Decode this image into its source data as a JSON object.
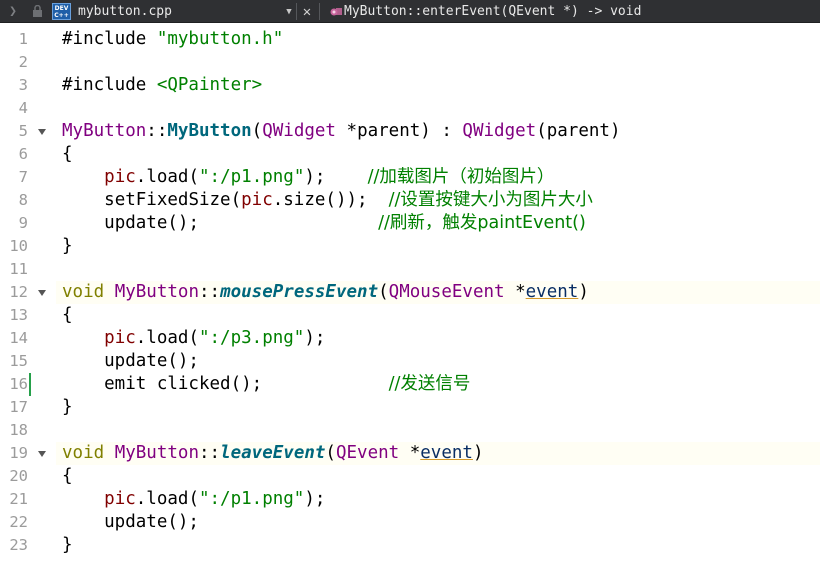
{
  "toolbar": {
    "file_name": "mybutton.cpp",
    "symbol": "MyButton::enterEvent(QEvent *) -> void",
    "dev_badge_top": "DEV",
    "dev_badge_bottom": "C++"
  },
  "editor": {
    "lines": [
      {
        "n": "1",
        "tokens": [
          [
            "op",
            "#include "
          ],
          [
            "str",
            "\"mybutton.h\""
          ]
        ]
      },
      {
        "n": "2",
        "tokens": []
      },
      {
        "n": "3",
        "tokens": [
          [
            "op",
            "#include "
          ],
          [
            "str",
            "<QPainter>"
          ]
        ]
      },
      {
        "n": "4",
        "tokens": []
      },
      {
        "n": "5",
        "fold": true,
        "tokens": [
          [
            "cls",
            "MyButton"
          ],
          [
            "op",
            "::"
          ],
          [
            "fn-bold",
            "MyButton"
          ],
          [
            "op",
            "("
          ],
          [
            "cls",
            "QWidget"
          ],
          [
            "op",
            " *"
          ],
          [
            "op",
            "parent) : "
          ],
          [
            "cls",
            "QWidget"
          ],
          [
            "op",
            "(parent)"
          ]
        ]
      },
      {
        "n": "6",
        "tokens": [
          [
            "op",
            "{"
          ]
        ]
      },
      {
        "n": "7",
        "tokens": [
          [
            "op",
            "    "
          ],
          [
            "mem",
            "pic"
          ],
          [
            "op",
            "."
          ],
          [
            "op",
            "load"
          ],
          [
            "op",
            "("
          ],
          [
            "str",
            "\":/p1.png\""
          ],
          [
            "op",
            ");    "
          ],
          [
            "cmt",
            "//加载图片（初始图片）"
          ]
        ]
      },
      {
        "n": "8",
        "tokens": [
          [
            "op",
            "    "
          ],
          [
            "op",
            "setFixedSize("
          ],
          [
            "mem",
            "pic"
          ],
          [
            "op",
            ".size());  "
          ],
          [
            "cmt",
            "//设置按键大小为图片大小"
          ]
        ]
      },
      {
        "n": "9",
        "tokens": [
          [
            "op",
            "    "
          ],
          [
            "op",
            "update();                 "
          ],
          [
            "cmt",
            "//刷新，触发paintEvent()"
          ]
        ]
      },
      {
        "n": "10",
        "tokens": [
          [
            "op",
            "}"
          ]
        ]
      },
      {
        "n": "11",
        "tokens": []
      },
      {
        "n": "12",
        "fold": true,
        "tokens": [
          [
            "kw",
            "void "
          ],
          [
            "cls",
            "MyButton"
          ],
          [
            "op",
            "::"
          ],
          [
            "fn-it",
            "mousePressEvent"
          ],
          [
            "op",
            "("
          ],
          [
            "cls",
            "QMouseEvent"
          ],
          [
            "op",
            " *"
          ],
          [
            "param",
            "event"
          ],
          [
            "op",
            ")"
          ]
        ]
      },
      {
        "n": "13",
        "tokens": [
          [
            "op",
            "{"
          ]
        ]
      },
      {
        "n": "14",
        "tokens": [
          [
            "op",
            "    "
          ],
          [
            "mem",
            "pic"
          ],
          [
            "op",
            ".load("
          ],
          [
            "str",
            "\":/p3.png\""
          ],
          [
            "op",
            ");"
          ]
        ]
      },
      {
        "n": "15",
        "tokens": [
          [
            "op",
            "    update();"
          ]
        ]
      },
      {
        "n": "16",
        "changed": true,
        "tokens": [
          [
            "op",
            "    emit clicked();            "
          ],
          [
            "cmt",
            "//发送信号"
          ]
        ]
      },
      {
        "n": "17",
        "tokens": [
          [
            "op",
            "}"
          ]
        ]
      },
      {
        "n": "18",
        "tokens": []
      },
      {
        "n": "19",
        "fold": true,
        "tokens": [
          [
            "kw",
            "void "
          ],
          [
            "cls",
            "MyButton"
          ],
          [
            "op",
            "::"
          ],
          [
            "fn-it",
            "leaveEvent"
          ],
          [
            "op",
            "("
          ],
          [
            "cls",
            "QEvent"
          ],
          [
            "op",
            " *"
          ],
          [
            "param",
            "event"
          ],
          [
            "op",
            ")"
          ]
        ]
      },
      {
        "n": "20",
        "tokens": [
          [
            "op",
            "{"
          ]
        ]
      },
      {
        "n": "21",
        "tokens": [
          [
            "op",
            "    "
          ],
          [
            "mem",
            "pic"
          ],
          [
            "op",
            ".load("
          ],
          [
            "str",
            "\":/p1.png\""
          ],
          [
            "op",
            ");"
          ]
        ]
      },
      {
        "n": "22",
        "tokens": [
          [
            "op",
            "    update();"
          ]
        ]
      },
      {
        "n": "23",
        "tokens": [
          [
            "op",
            "}"
          ]
        ]
      }
    ]
  },
  "colors": {
    "toolbar_bg": "#2f3033",
    "keyword": "#808000",
    "string": "#008000",
    "class": "#800080",
    "member": "#800000",
    "function": "#00677c",
    "change_marker": "#26a04a"
  }
}
